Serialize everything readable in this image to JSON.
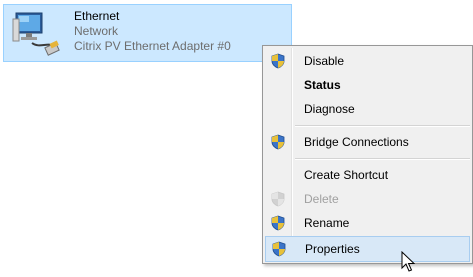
{
  "adapter": {
    "name": "Ethernet",
    "status": "Network",
    "device": "Citrix PV Ethernet Adapter #0",
    "icon": "network-adapter-icon"
  },
  "context_menu": {
    "items": [
      {
        "label": "Disable",
        "shield": true,
        "bold": false,
        "disabled": false
      },
      {
        "label": "Status",
        "shield": false,
        "bold": true,
        "disabled": false
      },
      {
        "label": "Diagnose",
        "shield": false,
        "bold": false,
        "disabled": false
      },
      {
        "label": "Bridge Connections",
        "shield": true,
        "bold": false,
        "disabled": false
      },
      {
        "label": "Create Shortcut",
        "shield": false,
        "bold": false,
        "disabled": false
      },
      {
        "label": "Delete",
        "shield": true,
        "bold": false,
        "disabled": true
      },
      {
        "label": "Rename",
        "shield": true,
        "bold": false,
        "disabled": false
      },
      {
        "label": "Properties",
        "shield": true,
        "bold": false,
        "disabled": false,
        "hovered": true
      }
    ]
  },
  "colors": {
    "selection_bg": "#cce8ff",
    "menu_bg": "#f0f0f0",
    "hover_bg": "#d8e8f7"
  }
}
